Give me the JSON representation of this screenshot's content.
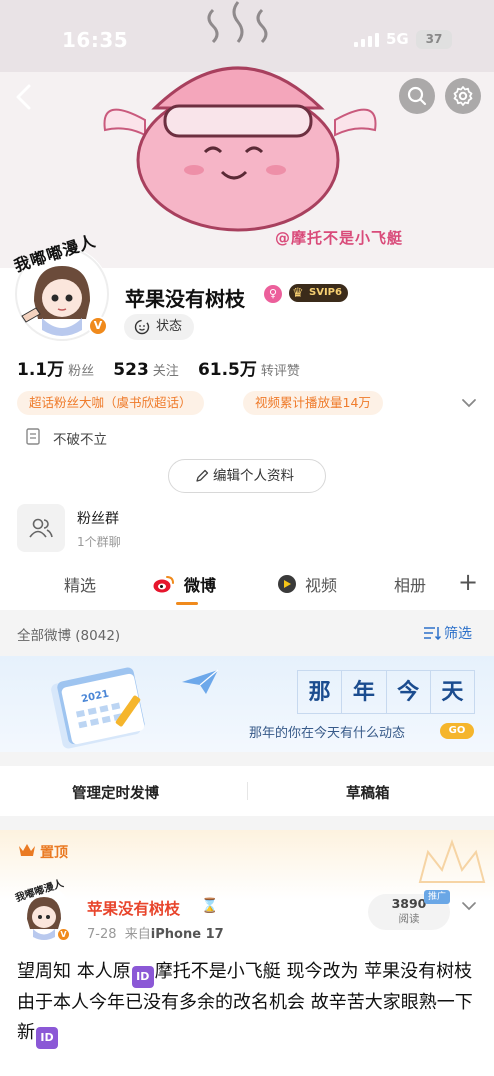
{
  "status_bar": {
    "time": "16:35",
    "network": "5G",
    "battery": "37"
  },
  "banner": {
    "watermark": "@摩托不是小飞艇"
  },
  "profile": {
    "avatar_sticker": "我嘟嘟漫人",
    "verified_badge": "V",
    "name": "苹果没有树枝",
    "svip_label": "SVIP6",
    "status_label": "状态",
    "stats": [
      {
        "value": "1.1万",
        "label": "粉丝"
      },
      {
        "value": "523",
        "label": "关注"
      },
      {
        "value": "61.5万",
        "label": "转评赞"
      }
    ],
    "tags": [
      "超话粉丝大咖（虞书欣超话）",
      "视频累计播放量14万"
    ],
    "bio": "不破不立",
    "edit_button": "编辑个人资料",
    "fans_group": {
      "title": "粉丝群",
      "subtitle": "1个群聊"
    }
  },
  "tabs": [
    {
      "label": "精选"
    },
    {
      "label": "微博"
    },
    {
      "label": "视频"
    },
    {
      "label": "相册"
    }
  ],
  "feed_header": {
    "all_label": "全部微博 (8042)",
    "filter_label": "筛选"
  },
  "memory_card": {
    "chars": [
      "那",
      "年",
      "今",
      "天"
    ],
    "subtitle": "那年的你在今天有什么动态",
    "go_label": "GO"
  },
  "actions": {
    "scheduled": "管理定时发博",
    "drafts": "草稿箱"
  },
  "pinned_post": {
    "pin_label": "置顶",
    "author": "苹果没有树枝",
    "date": "7-28",
    "source_prefix": "来自",
    "source": "iPhone 17",
    "read_count": "3890",
    "read_label": "阅读",
    "promo_label": "推广",
    "text_1": "望周知 本人原",
    "text_2": "摩托不是小飞艇 现今改为 苹果没有树枝 由于本人今年已没有多余的改名机会 故辛苦大家眼熟一下新",
    "id_badge": "ID"
  },
  "colors": {
    "accent": "#f08a1c",
    "name_red": "#e8452c",
    "link_blue": "#2c70c9",
    "tag_orange": "#ef7b2b"
  }
}
